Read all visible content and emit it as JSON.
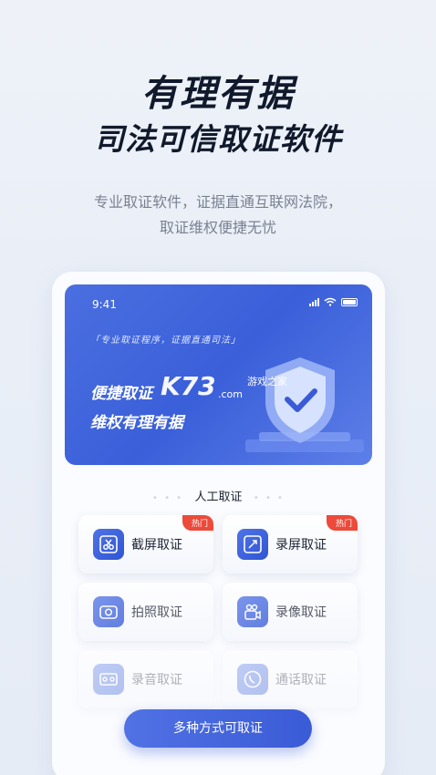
{
  "hero": {
    "title": "有理有据",
    "subtitle": "司法可信取证软件",
    "desc_line1": "专业取证软件，证据直通互联网法院，",
    "desc_line2": "取证维权便捷无忧"
  },
  "banner": {
    "time": "9:41",
    "tagline": "「专业取证程序，证据直通司法」",
    "line1": "便捷取证",
    "line2": "维权有理有据",
    "watermark": "K73",
    "watermark_sub1": "游戏之家",
    "watermark_sub2": ".com"
  },
  "section": {
    "title": "人工取证"
  },
  "tiles": [
    {
      "label": "截屏取证",
      "badge": "热门"
    },
    {
      "label": "录屏取证",
      "badge": "热门"
    },
    {
      "label": "拍照取证"
    },
    {
      "label": "录像取证"
    },
    {
      "label": "录音取证"
    },
    {
      "label": "通话取证"
    }
  ],
  "cta": {
    "label": "多种方式可取证"
  },
  "colors": {
    "accent": "#3a5bd6",
    "hot": "#ec4a3a"
  }
}
